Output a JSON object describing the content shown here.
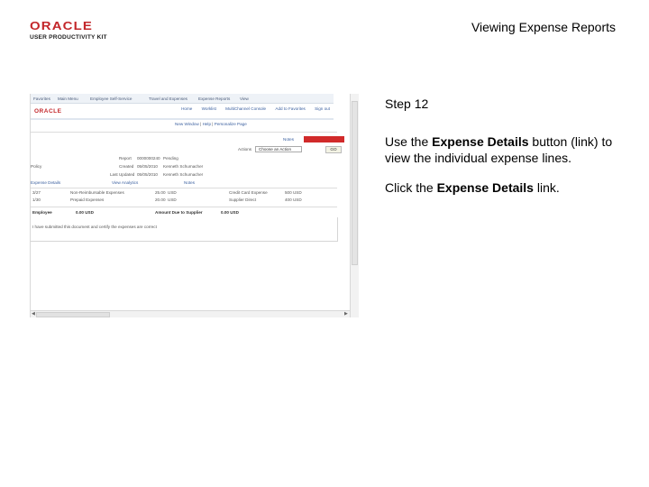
{
  "logo": {
    "brand": "ORACLE",
    "product": "USER PRODUCTIVITY KIT"
  },
  "header": {
    "title": "Viewing Expense Reports"
  },
  "screenshot": {
    "nav_items": [
      "Favorites",
      "Main Menu",
      "Employee Self-Service",
      "Travel and Expenses",
      "Expense Reports",
      "View"
    ],
    "brand": "ORACLE",
    "top_links": [
      "Home",
      "Worklist",
      "MultiChannel Console",
      "Add to Favorites",
      "Sign out"
    ],
    "links": [
      "New Window",
      "Help",
      "Personalize Page"
    ],
    "notes_label": "Notes",
    "action_label": "Actions",
    "action_value": "Choose an Action",
    "go_label": "GO",
    "fields": [
      {
        "label": "Report",
        "value": "0000000240",
        "extra": "Pending"
      },
      {
        "label": "Created",
        "value": "05/05/2010",
        "extra": "Kenneth Schumacher"
      },
      {
        "label": "Last Updated",
        "value": "05/05/2010",
        "extra": "Kenneth Schumacher"
      }
    ],
    "policy": "Policy",
    "expense_details_link": "Expense Details",
    "view_analytics": "View Analytics",
    "notes_link": "Notes",
    "lines": [
      {
        "code": "3/27",
        "desc": "Non-Reimbursable Expenses",
        "amount": "25.00",
        "currency": "USD",
        "payment": "Credit Card Expense",
        "total": "500 USD"
      },
      {
        "code": "1/30",
        "desc": "Prepaid Expenses",
        "amount": "20.00",
        "currency": "USD",
        "payment": "Supplier Direct",
        "total": "400 USD"
      }
    ],
    "totals": [
      {
        "label": "Employee",
        "value": "0.00 USD"
      },
      {
        "label": "Amount Due to Supplier",
        "value": "0.00 USD"
      }
    ],
    "comment": "I have submitted this document and certify the expenses are correct"
  },
  "step": {
    "label": "Step 12"
  },
  "instruction": {
    "line1_pre": "Use the ",
    "line1_bold": "Expense Details",
    "line1_post": " button (link) to view the individual expense lines.",
    "line2_pre": "Click the ",
    "line2_bold": "Expense Details",
    "line2_post": " link."
  }
}
